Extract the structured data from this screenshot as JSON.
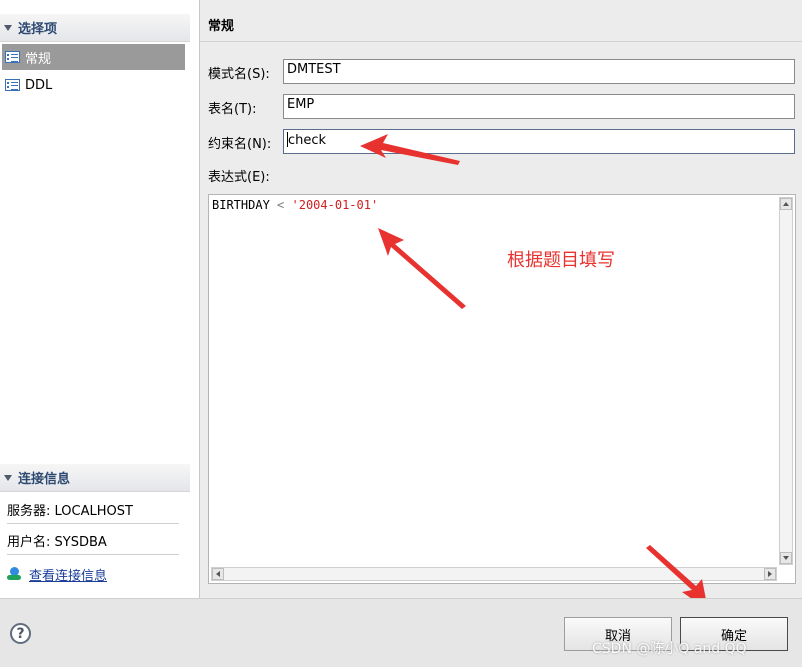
{
  "sidebar": {
    "options_header": "选择项",
    "items": [
      {
        "label": "常规",
        "selected": true,
        "icon": "list-icon"
      },
      {
        "label": "DDL",
        "selected": false,
        "icon": "list-icon"
      }
    ],
    "connection_header": "连接信息",
    "server_label": "服务器: LOCALHOST",
    "user_label": "用户名: SYSDBA",
    "view_link": "查看连接信息"
  },
  "main": {
    "header": "常规",
    "fields": {
      "schema_label": "模式名(S):",
      "schema_value": "DMTEST",
      "table_label": "表名(T):",
      "table_value": "EMP",
      "constraint_label": "约束名(N):",
      "constraint_value": "check",
      "expression_label": "表达式(E):"
    },
    "expression": {
      "column": "BIRTHDAY",
      "operator": "<",
      "literal": "'2004-01-01'"
    }
  },
  "annotation": {
    "text": "根据题目填写",
    "color": "#e8322f"
  },
  "footer": {
    "help": "?",
    "cancel": "取消",
    "ok": "确定"
  },
  "watermark": "CSDN @陈小Q and QQ"
}
